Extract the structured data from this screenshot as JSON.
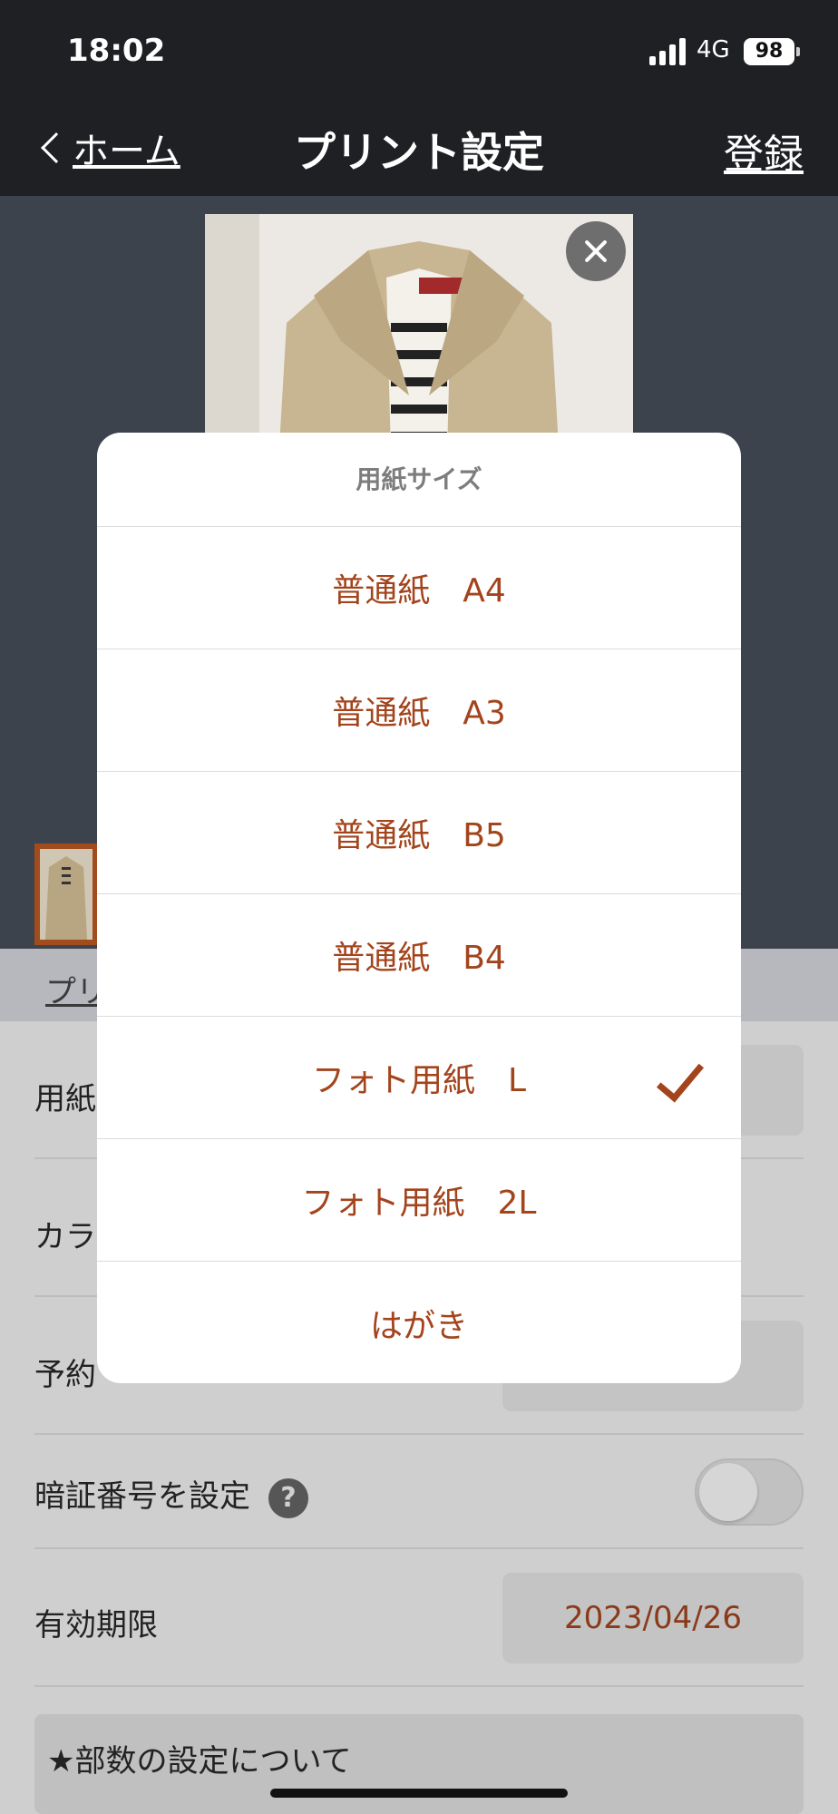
{
  "status_bar": {
    "time": "18:02",
    "network": "4G",
    "battery": "98"
  },
  "nav": {
    "back_label": "ホーム",
    "title": "プリント設定",
    "register_label": "登録"
  },
  "tabs": {
    "print_tab_label": "プリ"
  },
  "settings": {
    "paper_label": "用紙",
    "color_label": "カラ",
    "reserve_label": "予約",
    "pin_label": "暗証番号を設定",
    "help_icon": "?",
    "expiry_label": "有効期限",
    "expiry_value": "2023/04/26",
    "note": "★部数の設定について"
  },
  "modal": {
    "title": "用紙サイズ",
    "options": [
      {
        "label": "普通紙　A4"
      },
      {
        "label": "普通紙　A3"
      },
      {
        "label": "普通紙　B5"
      },
      {
        "label": "普通紙　B4"
      },
      {
        "label": "フォト用紙　L",
        "selected": true
      },
      {
        "label": "フォト用紙　2L"
      },
      {
        "label": "はがき"
      }
    ]
  },
  "colors": {
    "accent": "#a3441c",
    "nav_bg": "#1e2024"
  },
  "icons": {
    "close": "close-icon",
    "check": "checkmark-icon",
    "back": "chevron-left-icon",
    "help": "help-icon"
  }
}
